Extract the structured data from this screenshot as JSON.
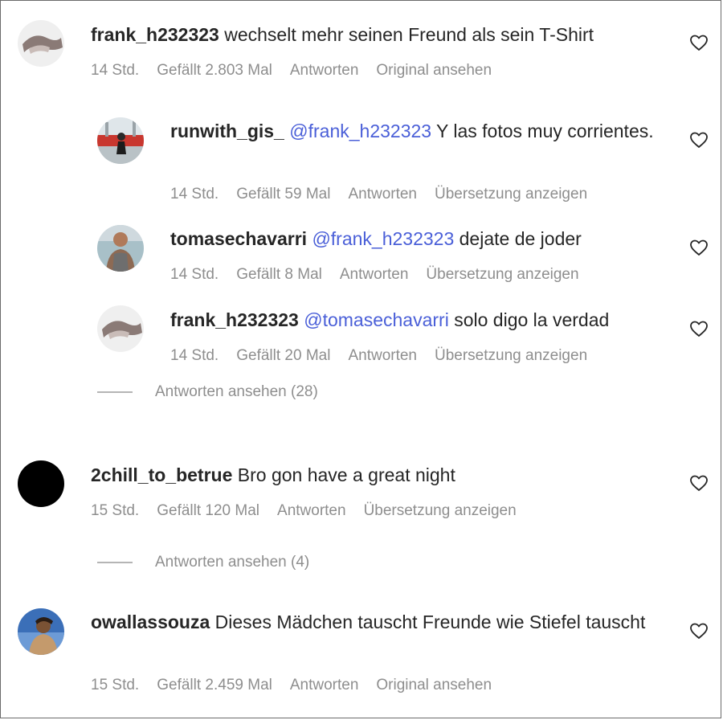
{
  "comments": [
    {
      "username": "frank_h232323",
      "mention": "",
      "text": "wechselt mehr seinen Freund als sein T-Shirt",
      "time": "14 Std.",
      "likes": "Gefällt 2.803 Mal",
      "reply": "Antworten",
      "extra": "Original ansehen"
    },
    {
      "username": "runwith_gis_",
      "mention": "@frank_h232323",
      "text": "Y las fotos muy corrientes.",
      "time": "14 Std.",
      "likes": "Gefällt 59 Mal",
      "reply": "Antworten",
      "extra": "Übersetzung anzeigen"
    },
    {
      "username": "tomasechavarri",
      "mention": "@frank_h232323",
      "text": "dejate de joder",
      "time": "14 Std.",
      "likes": "Gefällt 8 Mal",
      "reply": "Antworten",
      "extra": "Übersetzung anzeigen"
    },
    {
      "username": "frank_h232323",
      "mention": "@tomasechavarri",
      "text": "solo digo la verdad",
      "time": "14 Std.",
      "likes": "Gefällt 20 Mal",
      "reply": "Antworten",
      "extra": "Übersetzung anzeigen"
    },
    {
      "username": "2chill_to_betrue",
      "mention": "",
      "text": "Bro gon have a great night",
      "time": "15 Std.",
      "likes": "Gefällt 120 Mal",
      "reply": "Antworten",
      "extra": "Übersetzung anzeigen"
    },
    {
      "username": "owallassouza",
      "mention": "",
      "text": "Dieses Mädchen tauscht Freunde wie Stiefel tauscht",
      "time": "15 Std.",
      "likes": "Gefällt 2.459 Mal",
      "reply": "Antworten",
      "extra": "Original ansehen"
    }
  ],
  "view_replies": [
    {
      "label": "Antworten ansehen (28)"
    },
    {
      "label": "Antworten ansehen (4)"
    }
  ],
  "icons": {
    "like": "heart-outline-icon"
  }
}
